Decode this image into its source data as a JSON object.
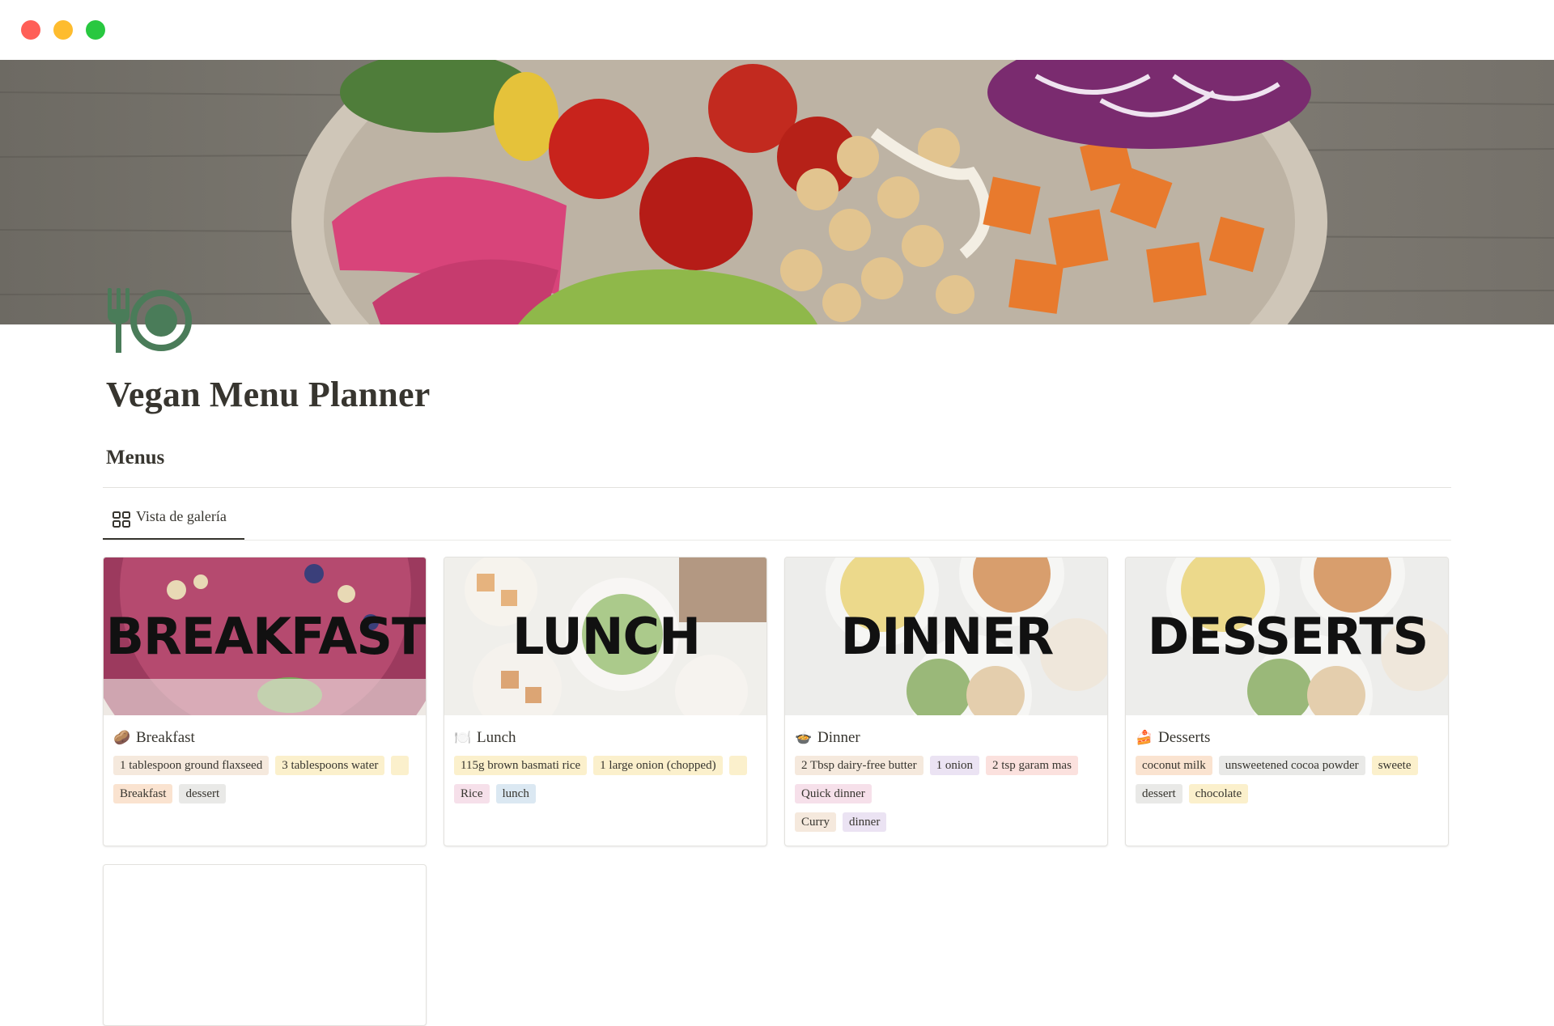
{
  "window": {
    "controls": [
      "close",
      "minimize",
      "maximize"
    ]
  },
  "cover": {
    "image": "vegan-bowl-cover-photo"
  },
  "page": {
    "icon": "fork-and-plate-icon",
    "icon_color": "#4a7c59",
    "title": "Vegan Menu Planner"
  },
  "section": {
    "title": "Menus"
  },
  "view_tab": {
    "label": "Vista de galería",
    "icon": "gallery-grid-icon"
  },
  "cards": [
    {
      "image_text": "BREAKFAST",
      "emoji": "🥔",
      "name": "Breakfast",
      "ingredients": [
        "1 tablespoon ground flaxseed",
        "3 tablespoons water",
        ""
      ],
      "tag_row_2": [
        "Breakfast",
        "dessert"
      ]
    },
    {
      "image_text": "LUNCH",
      "emoji": "🍽️",
      "name": "Lunch",
      "ingredients": [
        "115g brown basmati rice",
        "1 large onion (chopped)",
        ""
      ],
      "tag_row_2": [
        "Rice",
        "lunch"
      ]
    },
    {
      "image_text": "DINNER",
      "emoji": "🍲",
      "name": "Dinner",
      "ingredients": [
        "2 Tbsp dairy-free butter",
        "1 onion",
        "2 tsp garam mas"
      ],
      "tag_row_2": [
        "Quick dinner"
      ],
      "tag_row_3": [
        "Curry",
        "dinner"
      ]
    },
    {
      "image_text": "DESSERTS",
      "emoji": "🍰",
      "name": "Desserts",
      "ingredients": [
        "coconut milk",
        "unsweetened cocoa powder",
        "sweete"
      ],
      "tag_row_2": [
        "dessert",
        "chocolate"
      ]
    }
  ],
  "colors": {
    "text": "#37352f",
    "divider": "#e3e2de",
    "accent_icon": "#4a7c59"
  }
}
